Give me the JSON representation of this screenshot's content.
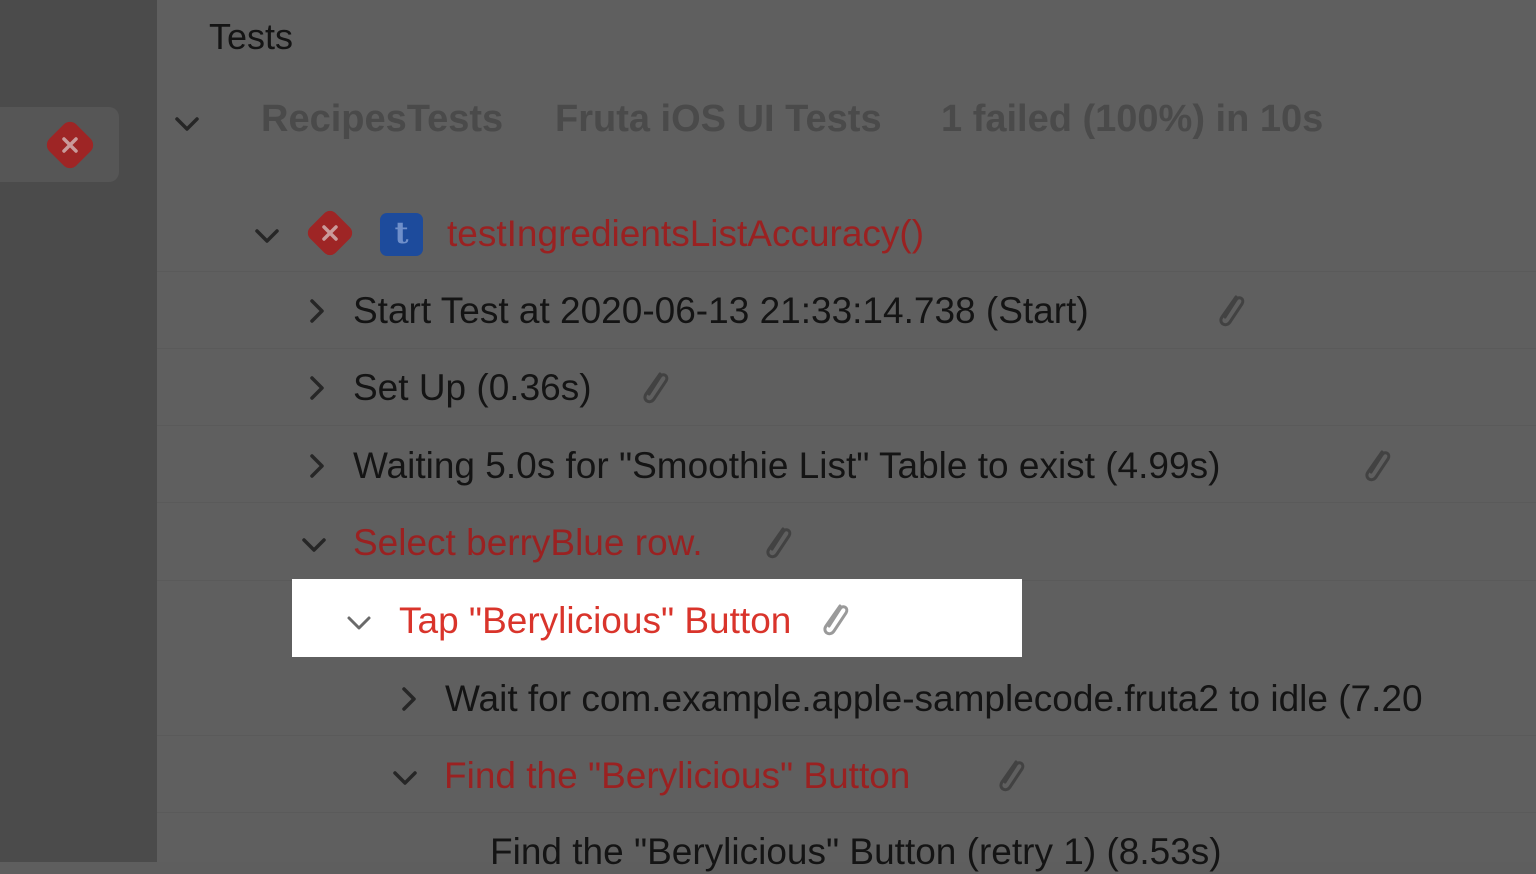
{
  "heading": "Tests",
  "suite": {
    "target": "RecipesTests",
    "plan": "Fruta iOS UI Tests",
    "summary": "1 failed (100%) in 10s"
  },
  "test": {
    "name": "testIngredientsListAccuracy()",
    "type_badge": "t",
    "status": "failed"
  },
  "steps": [
    {
      "label": "Start Test at 2020-06-13 21:33:14.738 (Start)",
      "expanded": false,
      "failed": false
    },
    {
      "label": "Set Up (0.36s)",
      "expanded": false,
      "failed": false
    },
    {
      "label": "Waiting 5.0s for \"Smoothie List\" Table to exist (4.99s)",
      "expanded": false,
      "failed": false
    },
    {
      "label": "Select berryBlue row.",
      "expanded": true,
      "failed": true
    },
    {
      "label": "Tap \"Berylicious\" Button",
      "expanded": true,
      "failed": true,
      "highlighted": true
    },
    {
      "label": "Wait for com.example.apple-samplecode.fruta2 to idle (7.20",
      "expanded": false,
      "failed": false
    },
    {
      "label": "Find the \"Berylicious\" Button",
      "expanded": true,
      "failed": true
    },
    {
      "label": "Find the \"Berylicious\" Button (retry 1) (8.53s)",
      "expanded": false,
      "failed": false
    }
  ],
  "colors": {
    "failure_red": "#d9342b",
    "dimmed_background": "#5f5f5f",
    "highlight_background": "#ffffff"
  },
  "icons": {
    "failure": "x-diamond-icon",
    "attachment": "paperclip-icon",
    "disclosure_open": "chevron-down-icon",
    "disclosure_closed": "chevron-right-icon"
  }
}
